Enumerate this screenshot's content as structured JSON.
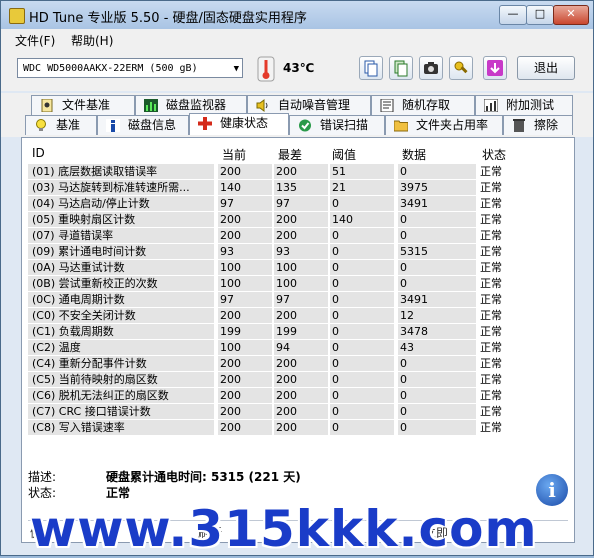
{
  "window": {
    "title": "HD Tune 专业版 5.50 - 硬盘/固态硬盘实用程序"
  },
  "menu": {
    "file": "文件(F)",
    "help": "帮助(H)"
  },
  "toolbar": {
    "drive": "WDC     WD5000AAKX-22ERM (500 gB)",
    "temperature": "43℃",
    "exit_label": "退出"
  },
  "tabs_top": [
    "文件基准",
    "磁盘监视器",
    "自动噪音管理",
    "随机存取",
    "附加测试"
  ],
  "tabs_bottom": [
    "基准",
    "磁盘信息",
    "健康状态",
    "错误扫描",
    "文件夹占用率",
    "擦除"
  ],
  "active_tab": "健康状态",
  "table": {
    "headers": {
      "id": "ID",
      "current": "当前",
      "worst": "最差",
      "threshold": "阈值",
      "data": "数据",
      "status": "状态"
    },
    "rows": [
      {
        "id": "(01) 底层数据读取错误率",
        "current": "200",
        "worst": "200",
        "threshold": "51",
        "data": "0",
        "status": "正常"
      },
      {
        "id": "(03) 马达旋转到标准转速所需...",
        "current": "140",
        "worst": "135",
        "threshold": "21",
        "data": "3975",
        "status": "正常"
      },
      {
        "id": "(04) 马达启动/停止计数",
        "current": "97",
        "worst": "97",
        "threshold": "0",
        "data": "3491",
        "status": "正常"
      },
      {
        "id": "(05) 重映射扇区计数",
        "current": "200",
        "worst": "200",
        "threshold": "140",
        "data": "0",
        "status": "正常"
      },
      {
        "id": "(07) 寻道错误率",
        "current": "200",
        "worst": "200",
        "threshold": "0",
        "data": "0",
        "status": "正常"
      },
      {
        "id": "(09) 累计通电时间计数",
        "current": "93",
        "worst": "93",
        "threshold": "0",
        "data": "5315",
        "status": "正常"
      },
      {
        "id": "(0A) 马达重试计数",
        "current": "100",
        "worst": "100",
        "threshold": "0",
        "data": "0",
        "status": "正常"
      },
      {
        "id": "(0B) 尝试重新校正的次数",
        "current": "100",
        "worst": "100",
        "threshold": "0",
        "data": "0",
        "status": "正常"
      },
      {
        "id": "(0C) 通电周期计数",
        "current": "97",
        "worst": "97",
        "threshold": "0",
        "data": "3491",
        "status": "正常"
      },
      {
        "id": "(C0) 不安全关闭计数",
        "current": "200",
        "worst": "200",
        "threshold": "0",
        "data": "12",
        "status": "正常"
      },
      {
        "id": "(C1) 负载周期数",
        "current": "199",
        "worst": "199",
        "threshold": "0",
        "data": "3478",
        "status": "正常"
      },
      {
        "id": "(C2) 温度",
        "current": "100",
        "worst": "94",
        "threshold": "0",
        "data": "43",
        "status": "正常"
      },
      {
        "id": "(C4) 重新分配事件计数",
        "current": "200",
        "worst": "200",
        "threshold": "0",
        "data": "0",
        "status": "正常"
      },
      {
        "id": "(C5) 当前待映射的扇区数",
        "current": "200",
        "worst": "200",
        "threshold": "0",
        "data": "0",
        "status": "正常"
      },
      {
        "id": "(C6) 脱机无法纠正的扇区数",
        "current": "200",
        "worst": "200",
        "threshold": "0",
        "data": "0",
        "status": "正常"
      },
      {
        "id": "(C7) CRC 接口错误计数",
        "current": "200",
        "worst": "200",
        "threshold": "0",
        "data": "0",
        "status": "正常"
      },
      {
        "id": "(C8) 写入错误速率",
        "current": "200",
        "worst": "200",
        "threshold": "0",
        "data": "0",
        "status": "正常"
      }
    ]
  },
  "details": {
    "desc_label": "描述:",
    "desc_value": "硬盘累计通电时间: 5315 (221 天)",
    "state_label": "状态:",
    "state_value": "正常"
  },
  "bottom": {
    "left_fragment": "健",
    "mid_fragment": "刷新",
    "right_fragment": "立即"
  },
  "watermark": "www.315kkk.com"
}
